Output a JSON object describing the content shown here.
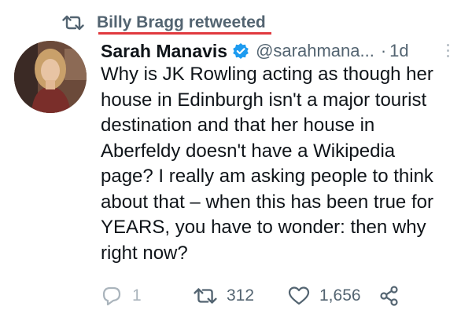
{
  "social_context": {
    "retweeted_by": "Billy Bragg retweeted",
    "icon": "retweet-icon"
  },
  "author": {
    "display_name": "Sarah Manavis",
    "verified": true,
    "handle": "@sarahmana...",
    "separator": "·",
    "timestamp": "1d"
  },
  "tweet": {
    "text": "Why is JK Rowling acting as though her\nhouse in Edinburgh isn't a major tourist\ndestination and that her house in\nAberfeldy doesn't have a Wikipedia\npage? I really am asking people to think\nabout that – when this has been true for\nYEARS, you have to wonder: then why\nright now?"
  },
  "actions": {
    "reply_count": "1",
    "retweet_count": "312",
    "like_count": "1,656"
  },
  "colors": {
    "text_primary": "#0f1419",
    "text_secondary": "#536471",
    "verified_blue": "#1d9bf0",
    "highlight_underline": "#e0393e"
  }
}
